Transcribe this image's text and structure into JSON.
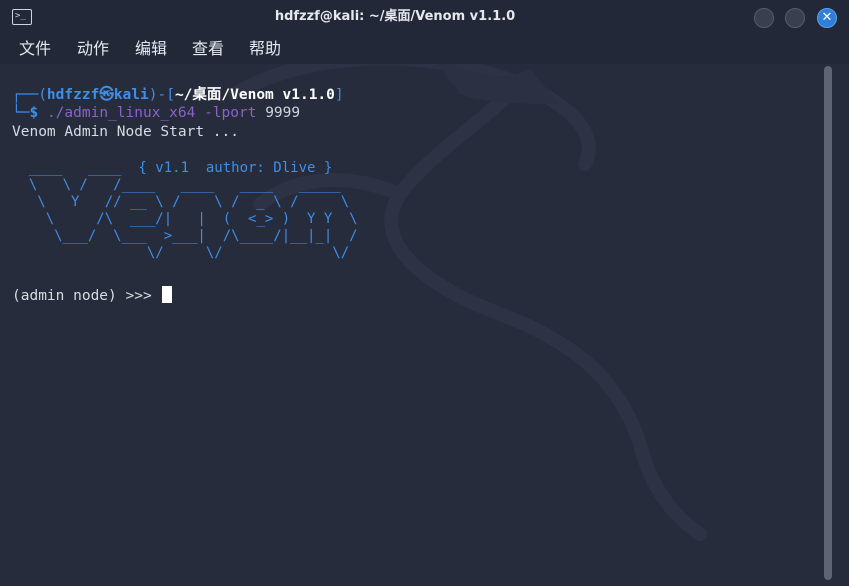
{
  "window": {
    "title": "hdfzzf@kali: ~/桌面/Venom v1.1.0"
  },
  "menu": {
    "items": [
      "文件",
      "动作",
      "编辑",
      "查看",
      "帮助"
    ]
  },
  "terminal": {
    "prompt_open": "┌──(",
    "prompt_user": "hdfzzf",
    "prompt_at": "㉿",
    "prompt_host": "kali",
    "prompt_mid": ")-[",
    "prompt_path": "~/桌面/Venom v1.1.0",
    "prompt_close": "]",
    "prompt_line2": "└─",
    "prompt_dollar": "$",
    "command": "./admin_linux_x64",
    "command_flag": "-lport",
    "command_arg": "9999",
    "output_start": "Venom Admin Node Start ...",
    "banner": "  ____   ____  { v1.1  author: Dlive }\n  \\   \\ /   /____   ____   ____   _____\n   \\   Y   // __ \\ /    \\ /  _ \\ /     \\\n    \\     /\\  ___/|   |  (  <_> )  Y Y  \\\n     \\___/  \\___  >___|  /\\____/|__|_|  /\n                \\/     \\/             \\/",
    "admin_prompt": "(admin node) >>> "
  },
  "colors": {
    "background": "#262c3b",
    "accent_blue": "#3f8ee8",
    "close_button": "#2f7fd8",
    "command_purple": "#8a63c9"
  }
}
